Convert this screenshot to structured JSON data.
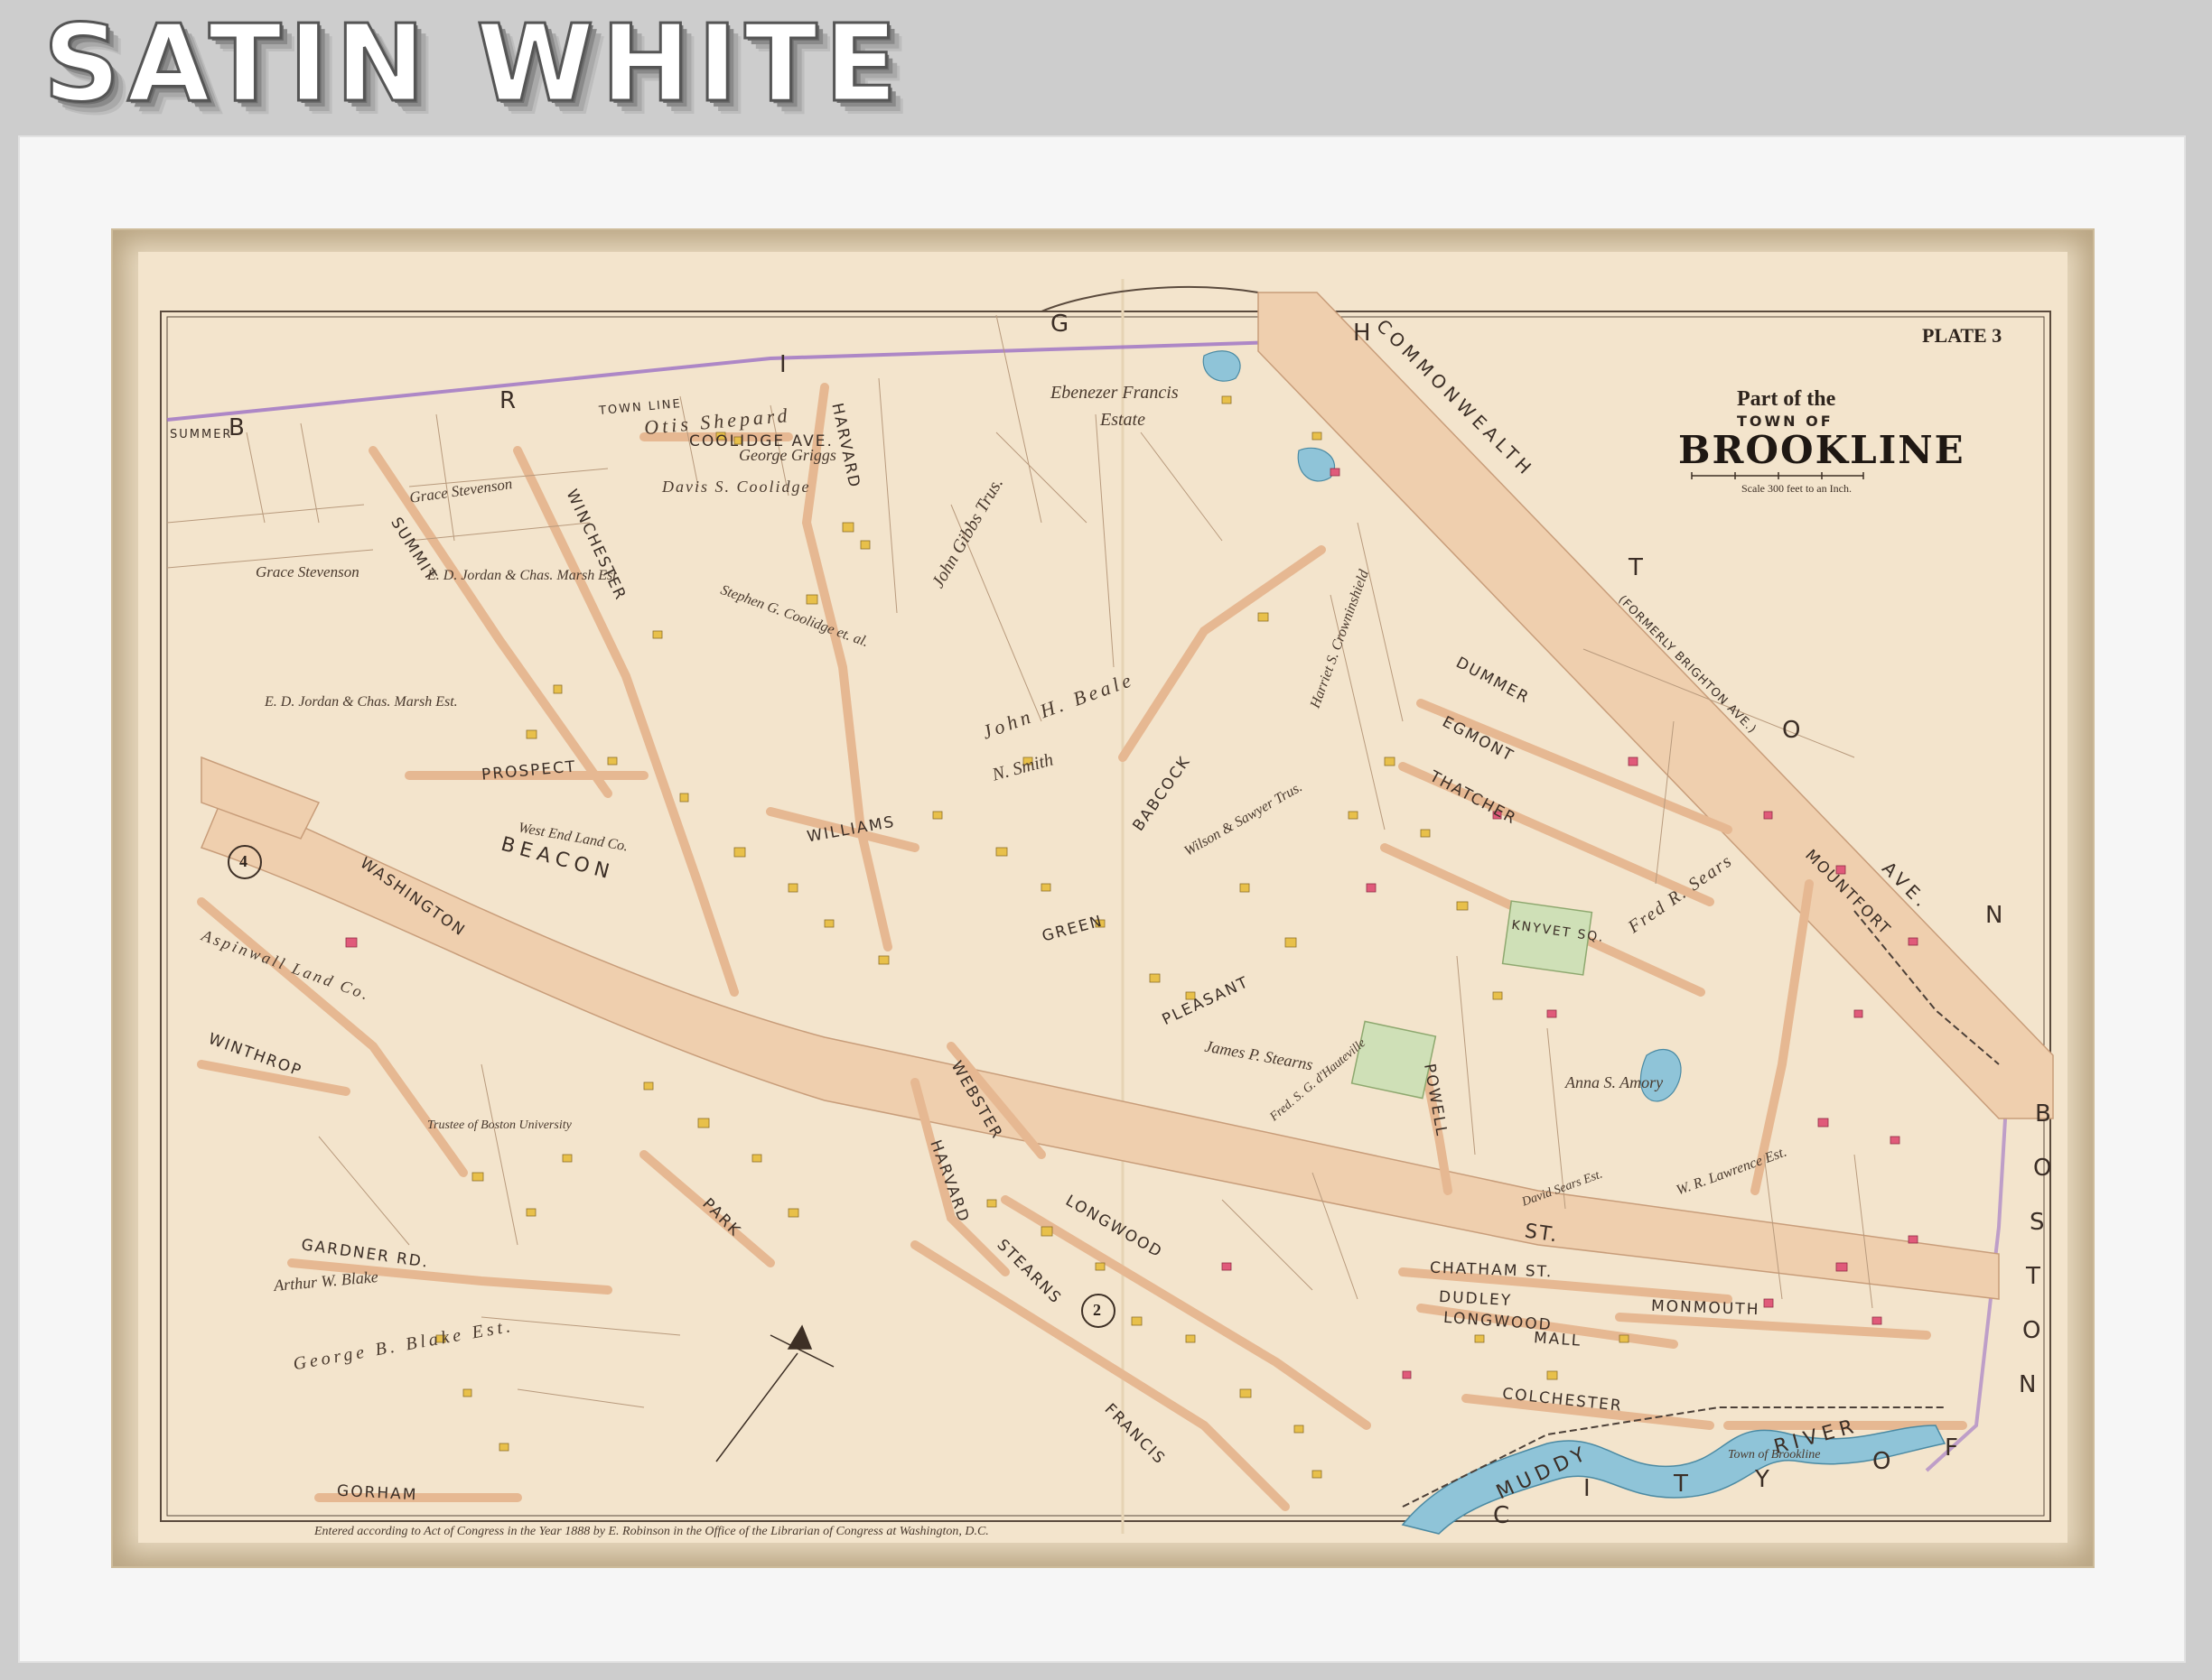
{
  "banner": {
    "text": "SATIN WHITE"
  },
  "map": {
    "plate": "PLATE 3",
    "title_part": "Part of the",
    "title_town": "TOWN OF",
    "title_main": "BROOKLINE",
    "scale_text": "Scale 300 feet to an Inch.",
    "copyright": "Entered according to Act of Congress in the Year 1888 by E. Robinson in the Office of the Librarian of Congress at Washington, D.C.",
    "circled_numbers": [
      "4",
      "2"
    ],
    "border_letters": [
      "B",
      "R",
      "I",
      "G",
      "H",
      "T",
      "O",
      "N"
    ],
    "boston_letters": [
      "B",
      "O",
      "S",
      "T",
      "O",
      "N"
    ],
    "city_of_letters": [
      "C",
      "I",
      "T",
      "Y",
      "O",
      "F"
    ],
    "streets": {
      "beacon": "BEACON",
      "st": "ST.",
      "commonwealth": "COMMONWEALTH",
      "ave": "AVE.",
      "formerly": "(FORMERLY BRIGHTON AVE.)",
      "washington": "WASHINGTON",
      "harvard": "HARVARD",
      "summit": "SUMMIT",
      "winchester": "WINCHESTER",
      "coolidge": "COOLIDGE AVE.",
      "babcock": "BABCOCK",
      "longwood_ave": "LONGWOOD",
      "longwood_mall": "LONGWOOD",
      "mall": "MALL",
      "chatham": "CHATHAM ST.",
      "monmouth": "MONMOUTH",
      "dudley": "DUDLEY",
      "colchester": "COLCHESTER",
      "gardner_rd": "GARDNER RD.",
      "gorham": "GORHAM",
      "park": "PARK",
      "stearns": "STEARNS",
      "francis": "FRANCIS",
      "powell": "POWELL",
      "dummer": "DUMMER",
      "egmont": "EGMONT",
      "thatcher": "THATCHER",
      "knyvet_sq": "KNYVET SQ.",
      "winthrop": "WINTHROP",
      "prospect": "PROSPECT",
      "pleasant": "PLEASANT",
      "green": "GREEN",
      "williams": "WILLIAMS",
      "webster": "WEBSTER",
      "mountfort": "MOUNTFORT",
      "muddy_river": "MUDDY",
      "river": "RIVER",
      "summer": "SUMMER",
      "town_line": "TOWN  LINE"
    },
    "owners": {
      "otis_shepard": "Otis Shepard",
      "george_griggs": "George Griggs",
      "ebenezer_francis": "Ebenezer Francis",
      "estate": "Estate",
      "davis_coolidge": "Davis S. Coolidge",
      "grace_stevenson_1": "Grace Stevenson",
      "grace_stevenson_2": "Grace Stevenson",
      "jordan_marsh_1": "E. D. Jordan & Chas. Marsh Est.",
      "jordan_marsh_2": "E. D. Jordan & Chas. Marsh Est.",
      "john_gibbs": "John Gibbs Trus.",
      "john_beale": "John H. Beale",
      "n_smith": "N. Smith",
      "stephen_coolidge": "Stephen G. Coolidge et. al.",
      "west_end_land": "West End Land Co.",
      "aspinwall": "Aspinwall Land Co.",
      "trustee_boston": "Trustee of Boston University",
      "george_blake": "George B. Blake Est.",
      "arthur_blake": "Arthur W. Blake",
      "james_stearns": "James P. Stearns",
      "wilson_sawyer": "Wilson & Sawyer Trus.",
      "anna_amory": "Anna S. Amory",
      "fred_sears": "Fred R. Sears",
      "harriet_crowninshield": "Harriet S. Crowninshield",
      "david_sears_est": "David Sears Est.",
      "w_r_lawrence": "W. R. Lawrence Est.",
      "fred_hunneville": "Fred. S. G. d'Hauteville",
      "town_of_brookline": "Town of Brookline"
    }
  }
}
